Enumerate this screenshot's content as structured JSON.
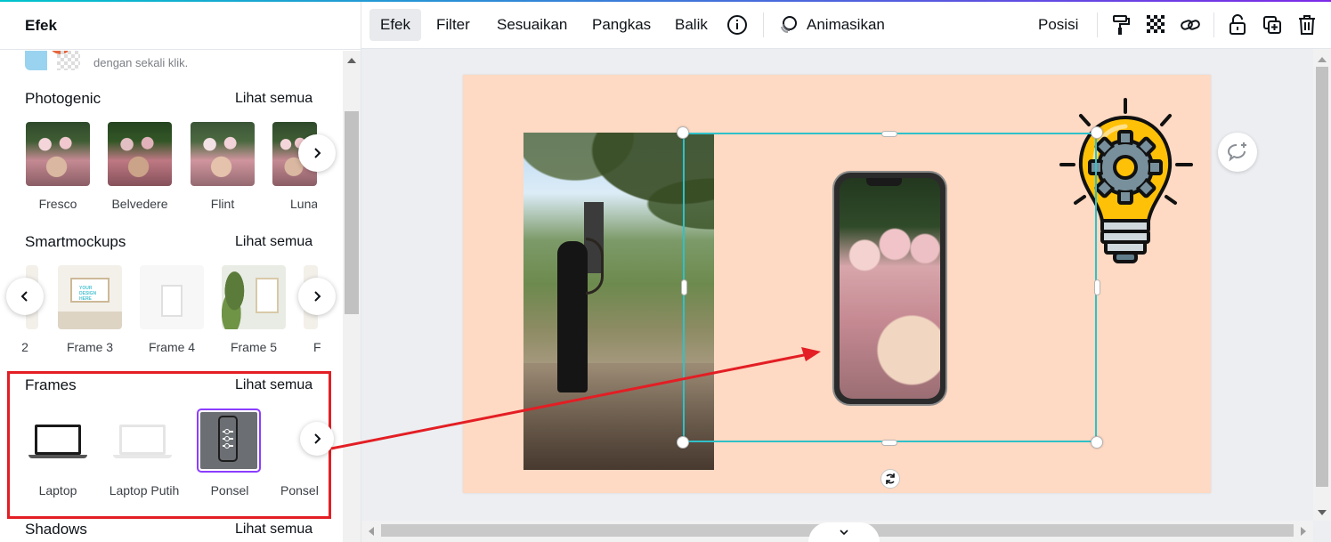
{
  "panel": {
    "title": "Efek",
    "bg_remover_text": "dengan sekali klik.",
    "sections": {
      "photogenic": {
        "title": "Photogenic",
        "see_all": "Lihat semua",
        "items": [
          "Fresco",
          "Belvedere",
          "Flint",
          "Luna"
        ]
      },
      "smartmockups": {
        "title": "Smartmockups",
        "see_all": "Lihat semua",
        "items": [
          "2",
          "Frame 3",
          "Frame 4",
          "Frame 5",
          "F"
        ],
        "mockup_text": "YOUR DESIGN HERE"
      },
      "frames": {
        "title": "Frames",
        "see_all": "Lihat semua",
        "items": [
          "Laptop",
          "Laptop Putih",
          "Ponsel",
          "Ponsel"
        ],
        "selected": "Ponsel"
      },
      "shadows": {
        "title": "Shadows",
        "see_all": "Lihat semua"
      }
    }
  },
  "toolbar": {
    "efek": "Efek",
    "filter": "Filter",
    "sesuaikan": "Sesuaikan",
    "pangkas": "Pangkas",
    "balik": "Balik",
    "animasikan": "Animasikan",
    "posisi": "Posisi",
    "icons": [
      "info-icon",
      "animate-icon",
      "paint-roller-icon",
      "transparency-icon",
      "link-icon",
      "lock-icon",
      "duplicate-icon",
      "trash-icon"
    ]
  },
  "colors": {
    "canvas_bg": "#fed9c3",
    "selection": "#2fc1c9",
    "annotation": "#e31e24",
    "selected_thumb": "#8b3dff"
  }
}
